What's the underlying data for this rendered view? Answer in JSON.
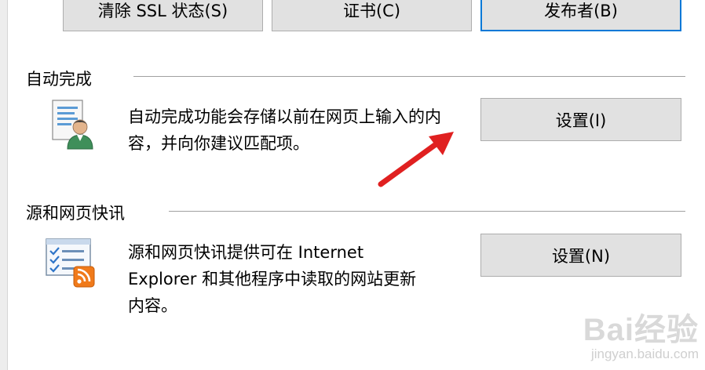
{
  "top_buttons": {
    "clear_ssl": "清除 SSL 状态(S)",
    "certificates": "证书(C)",
    "publishers": "发布者(B)"
  },
  "autocomplete": {
    "title": "自动完成",
    "description": "自动完成功能会存储以前在网页上输入的内容，并向你建议匹配项。",
    "settings_button": "设置(I)",
    "icon": "user-form-icon"
  },
  "feeds": {
    "title": "源和网页快讯",
    "description_line1": "源和网页快讯提供可在 Internet",
    "description_line2": "Explorer 和其他程序中读取的网站更新",
    "description_line3": "内容。",
    "settings_button": "设置(N)",
    "icon": "rss-feed-icon"
  },
  "annotation": {
    "arrow_color": "#e02020"
  },
  "watermark": {
    "brand": "Bai经验",
    "url": "jingyan.baidu.com"
  },
  "colors": {
    "accent": "#0078d7",
    "button_bg": "#e1e1e1"
  }
}
